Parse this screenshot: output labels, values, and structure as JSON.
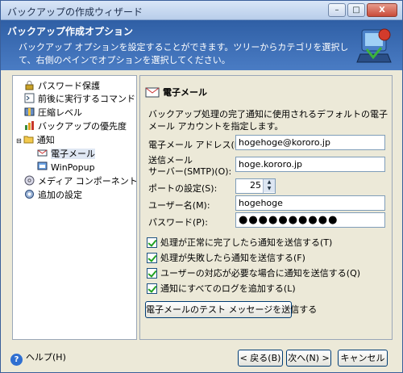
{
  "window": {
    "title": "バックアップの作成ウィザード",
    "controls": {
      "minimize": "–",
      "maximize": "□",
      "close": "X"
    }
  },
  "header": {
    "title": "バックアップ作成オプション",
    "description": "バックアップ オプションを設定することができます。ツリーからカテゴリを選択して、右側のペインでオプションを選択してください。"
  },
  "tree": {
    "items": [
      {
        "label": "パスワード保護",
        "icon": "lock-icon"
      },
      {
        "label": "前後に実行するコマンド",
        "icon": "command-icon"
      },
      {
        "label": "圧縮レベル",
        "icon": "compress-icon"
      },
      {
        "label": "バックアップの優先度",
        "icon": "priority-icon"
      },
      {
        "label": "通知",
        "icon": "folder-icon"
      },
      {
        "label": "電子メール",
        "icon": "email-icon"
      },
      {
        "label": "WinPopup",
        "icon": "popup-icon"
      },
      {
        "label": "メディア コンポーネント",
        "icon": "media-icon"
      },
      {
        "label": "追加の設定",
        "icon": "settings-icon"
      }
    ]
  },
  "panel": {
    "heading": "電子メール",
    "description": "バックアップ処理の完了通知に使用されるデフォルトの電子メール アカウントを指定します。",
    "email_label": "電子メール アドレス(E):",
    "email_value": "hogehoge@kororo.jp",
    "smtp_label_line1": "送信メール",
    "smtp_label_line2": "サーバー(SMTP)(O):",
    "smtp_value": "hoge.kororo.jp",
    "port_label": "ポートの設定(S):",
    "port_value": "25",
    "user_label": "ユーザー名(M):",
    "user_value": "hogehoge",
    "password_label": "パスワード(P):",
    "password_value": "●●●●●●●●●●",
    "checkboxes": [
      {
        "label": "処理が正常に完了したら通知を送信する(T)",
        "checked": true
      },
      {
        "label": "処理が失敗したら通知を送信する(F)",
        "checked": true
      },
      {
        "label": "ユーザーの対応が必要な場合に通知を送信する(Q)",
        "checked": true
      },
      {
        "label": "通知にすべてのログを追加する(L)",
        "checked": true
      }
    ],
    "test_button": "電子メールのテスト メッセージを送信する"
  },
  "footer": {
    "help": "ヘルプ(H)",
    "back": "< 戻る(B)",
    "next": "次へ(N) >",
    "cancel": "キャンセル"
  }
}
